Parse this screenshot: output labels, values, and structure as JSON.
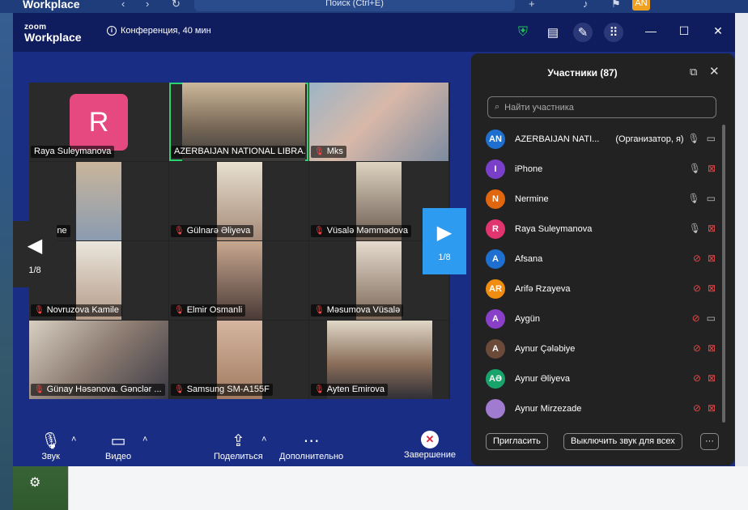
{
  "outer": {
    "app_title": "Workplace",
    "search_label": "Поиск (Ctrl+E)",
    "avatar": "AN"
  },
  "header": {
    "logo_small": "zoom",
    "logo_big": "Workplace",
    "meeting_label": "Конференция, 40 мин"
  },
  "tiles": [
    {
      "name": "Raya Suleymanova",
      "avatar_letter": "R",
      "muted": false
    },
    {
      "name": "AZERBAIJAN NATIONAL LIBRA...",
      "muted": false
    },
    {
      "name": "Mks",
      "muted": true
    },
    {
      "name": "ine",
      "muted": false
    },
    {
      "name": "Gülnarə Əliyeva",
      "muted": true
    },
    {
      "name": "Vüsalə Məmmədova",
      "muted": true
    },
    {
      "name": "Novruzova Kamile",
      "muted": true
    },
    {
      "name": "Elmir Osmanli",
      "muted": true
    },
    {
      "name": "Məsumova Vüsalə",
      "muted": true
    },
    {
      "name": "Günay Həsənova. Gənclər ...",
      "muted": true
    },
    {
      "name": "Samsung SM-A155F",
      "muted": true
    },
    {
      "name": "Ayten Emirova",
      "muted": true
    }
  ],
  "pager": {
    "left": "1/8",
    "right": "1/8"
  },
  "toolbar": {
    "audio": "Звук",
    "video": "Видео",
    "share": "Поделиться",
    "more": "Дополнительно",
    "end": "Завершение"
  },
  "panel": {
    "title": "Участники (87)",
    "search_placeholder": "Найти участника",
    "participants": [
      {
        "initials": "AN",
        "name": "AZERBAIJAN NATI...",
        "role": "(Организатор, я)",
        "color": "#1f6fd0",
        "mic": "on",
        "cam": "on"
      },
      {
        "initials": "I",
        "name": "iPhone",
        "role": "",
        "color": "#7a3fc8",
        "mic": "on",
        "cam": "off"
      },
      {
        "initials": "N",
        "name": "Nermine",
        "role": "",
        "color": "#e0660f",
        "mic": "on",
        "cam": "on"
      },
      {
        "initials": "R",
        "name": "Raya Suleymanova",
        "role": "",
        "color": "#e0356e",
        "mic": "on",
        "cam": "off"
      },
      {
        "initials": "A",
        "name": "Afsana",
        "role": "",
        "color": "#1f6fd0",
        "mic": "off",
        "cam": "off"
      },
      {
        "initials": "AR",
        "name": "Arifə Rzayeva",
        "role": "",
        "color": "#f08c10",
        "mic": "off",
        "cam": "off"
      },
      {
        "initials": "A",
        "name": "Aygün",
        "role": "",
        "color": "#8a3fc8",
        "mic": "off",
        "cam": "on"
      },
      {
        "initials": "A",
        "name": "Aynur Çələbiye",
        "role": "",
        "color": "#6b4a3a",
        "mic": "off",
        "cam": "off"
      },
      {
        "initials": "AƏ",
        "name": "Aynur Əliyeva",
        "role": "",
        "color": "#17a36a",
        "mic": "off",
        "cam": "off"
      },
      {
        "initials": "",
        "name": "Aynur Mirzezade",
        "role": "",
        "color": "#a07bd0",
        "mic": "off",
        "cam": "off"
      }
    ],
    "invite": "Пригласить",
    "mute_all": "Выключить звук для всех",
    "more": "···"
  }
}
